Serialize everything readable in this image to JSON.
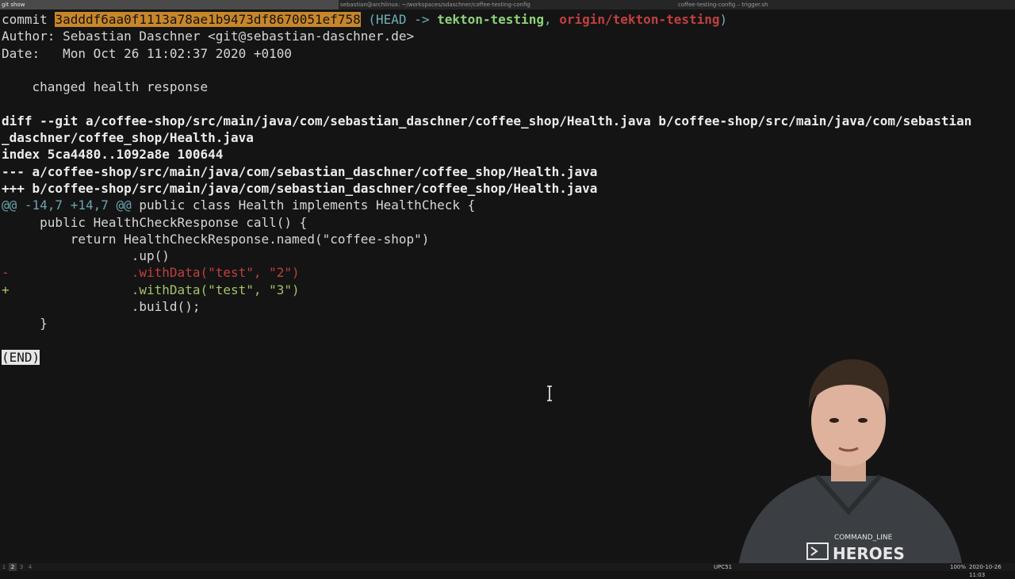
{
  "tabs": [
    {
      "label": "git show",
      "active": true
    },
    {
      "label": "sebastian@archlinux: ~/workspaces/sdaschner/coffee-testing-config",
      "active": false
    },
    {
      "label": "coffee-testing-config – trigger.sh",
      "active": false
    }
  ],
  "commit": {
    "keyword": "commit",
    "hash": "3adddf6aa0f1113a78ae1b9473df8670051ef758",
    "ref_open": "(HEAD -> ",
    "local_branch": "tekton-testing",
    "comma": ", ",
    "remote_branch": "origin/tekton-testing",
    "ref_close": ")",
    "author_line": "Author: Sebastian Daschner <git@sebastian-daschner.de>",
    "date_line": "Date:   Mon Oct 26 11:02:37 2020 +0100",
    "message": "    changed health response"
  },
  "diff": {
    "header_line1": "diff --git a/coffee-shop/src/main/java/com/sebastian_daschner/coffee_shop/Health.java b/coffee-shop/src/main/java/com/sebastian",
    "header_line2": "_daschner/coffee_shop/Health.java",
    "index_line": "index 5ca4480..1092a8e 100644",
    "minus_file": "--- a/coffee-shop/src/main/java/com/sebastian_daschner/coffee_shop/Health.java",
    "plus_file": "+++ b/coffee-shop/src/main/java/com/sebastian_daschner/coffee_shop/Health.java",
    "hunk_marker": "@@ -14,7 +14,7 @@",
    "hunk_context": " public class Health implements HealthCheck {",
    "lines": [
      "     public HealthCheckResponse call() {",
      "         return HealthCheckResponse.named(\"coffee-shop\")",
      "                 .up()"
    ],
    "removed": "-                .withData(\"test\", \"2\")",
    "added": "+                .withData(\"test\", \"3\")",
    "tail": [
      "                 .build();",
      "     }"
    ]
  },
  "pager_end": "(END)",
  "statusbar": {
    "workspaces": [
      "1",
      "2",
      "3",
      "4"
    ],
    "active_workspace": "2",
    "right_items": [
      "UPC51",
      "100%",
      "2020-10-26 11:03"
    ]
  },
  "presenter_shirt_text": [
    "COMMAND_LINE",
    "HEROES"
  ],
  "colors": {
    "hash_highlight": "#c8862a",
    "local_branch": "#8fd27a",
    "remote_branch": "#c2403f",
    "removed": "#c0403f",
    "added": "#a3c26b",
    "hunk": "#6aa4b0"
  }
}
